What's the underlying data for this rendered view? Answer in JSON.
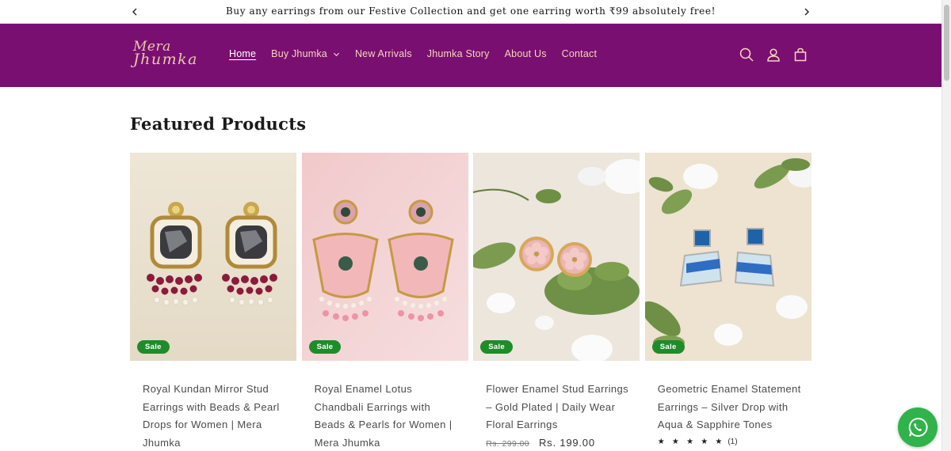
{
  "announcement": {
    "message": "Buy any earrings from our Festive Collection and get one earring worth ₹99 absolutely free!"
  },
  "brand": {
    "logo_line1": "Mera",
    "logo_line2": "Jhumka",
    "header_color": "#7a0f72",
    "logo_color": "#e7c9a8"
  },
  "nav": {
    "items": [
      {
        "label": "Home",
        "active": true
      },
      {
        "label": "Buy Jhumka",
        "has_dropdown": true
      },
      {
        "label": "New Arrivals"
      },
      {
        "label": "Jhumka Story"
      },
      {
        "label": "About Us"
      },
      {
        "label": "Contact"
      }
    ]
  },
  "header_icons": [
    "search-icon",
    "account-icon",
    "cart-icon"
  ],
  "section": {
    "title": "Featured Products"
  },
  "products": [
    {
      "badge": "Sale",
      "title": "Royal Kundan Mirror Stud Earrings with Beads & Pearl Drops for Women | Mera Jhumka"
    },
    {
      "badge": "Sale",
      "title": "Royal Enamel Lotus Chandbali Earrings with Beads & Pearls for Women | Mera Jhumka"
    },
    {
      "badge": "Sale",
      "title": "Flower Enamel Stud Earrings – Gold Plated | Daily Wear Floral Earrings",
      "price_old": "Rs. 299.00",
      "price_new": "Rs. 199.00"
    },
    {
      "badge": "Sale",
      "title": "Geometric Enamel Statement Earrings – Silver Drop with Aqua & Sapphire Tones",
      "stars": "★ ★ ★ ★ ★",
      "rating_count": "(1)",
      "rating": 5
    }
  ],
  "badge_color": "#1e8c2a",
  "whatsapp_color": "#2fb34a"
}
